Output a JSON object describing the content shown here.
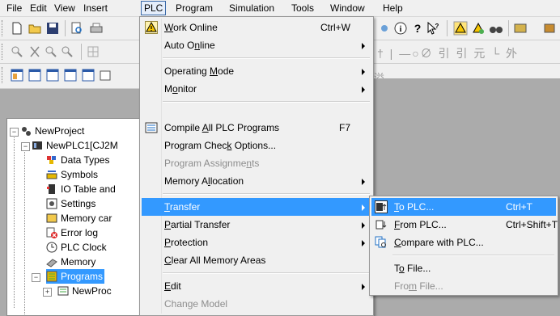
{
  "menubar": {
    "items": [
      "File",
      "Edit",
      "View",
      "Insert",
      "PLC",
      "Program",
      "Simulation",
      "Tools",
      "Window",
      "Help"
    ]
  },
  "toolbar_ghost": {
    "row2_glyphs": "† | —○∅ 引 引 元 └ 外",
    "row3_glyph": "溢"
  },
  "tree": {
    "project": "NewProject",
    "plc": "NewPLC1[CJ2M",
    "items": [
      "Data Types",
      "Symbols",
      "IO Table and",
      "Settings",
      "Memory car",
      "Error log",
      "PLC Clock",
      "Memory",
      "Programs",
      "NewProc"
    ]
  },
  "plc_menu": {
    "work_online": {
      "pre": "",
      "u": "W",
      "post": "ork Online",
      "shortcut": "Ctrl+W"
    },
    "auto_online": {
      "pre": "Auto O",
      "u": "n",
      "post": "line"
    },
    "operating_mode": {
      "pre": "Operating ",
      "u": "M",
      "post": "ode"
    },
    "monitor": {
      "pre": "M",
      "u": "o",
      "post": "nitor"
    },
    "compile": {
      "pre": "Compile ",
      "u": "A",
      "post": "ll PLC Programs",
      "shortcut": "F7"
    },
    "check_options": {
      "pre": "Program Chec",
      "u": "k",
      "post": " Options..."
    },
    "program_assignments": {
      "pre": "Program Assignme",
      "u": "n",
      "post": "ts"
    },
    "memory_allocation": {
      "pre": "Memory A",
      "u": "l",
      "post": "location"
    },
    "transfer": {
      "pre": "",
      "u": "T",
      "post": "ransfer"
    },
    "partial_transfer": {
      "pre": "",
      "u": "P",
      "post": "artial Transfer"
    },
    "protection": {
      "pre": "",
      "u": "P",
      "post": "rotection"
    },
    "clear_memory": {
      "pre": "",
      "u": "C",
      "post": "lear All Memory Areas"
    },
    "edit": {
      "pre": "",
      "u": "E",
      "post": "dit"
    },
    "change_model": {
      "label": "Change Model"
    }
  },
  "transfer_menu": {
    "to_plc": {
      "pre": "",
      "u": "T",
      "post": "o PLC...",
      "shortcut": "Ctrl+T"
    },
    "from_plc": {
      "pre": "",
      "u": "F",
      "post": "rom PLC...",
      "shortcut": "Ctrl+Shift+T"
    },
    "compare": {
      "pre": "",
      "u": "C",
      "post": "ompare with PLC..."
    },
    "to_file": {
      "pre": "T",
      "u": "o",
      "post": " File..."
    },
    "from_file": {
      "pre": "Fro",
      "u": "m",
      "post": " File..."
    }
  },
  "colors": {
    "highlight": "#3399ff",
    "menu_bg": "#f0f0f0",
    "workspace": "#ababab"
  }
}
